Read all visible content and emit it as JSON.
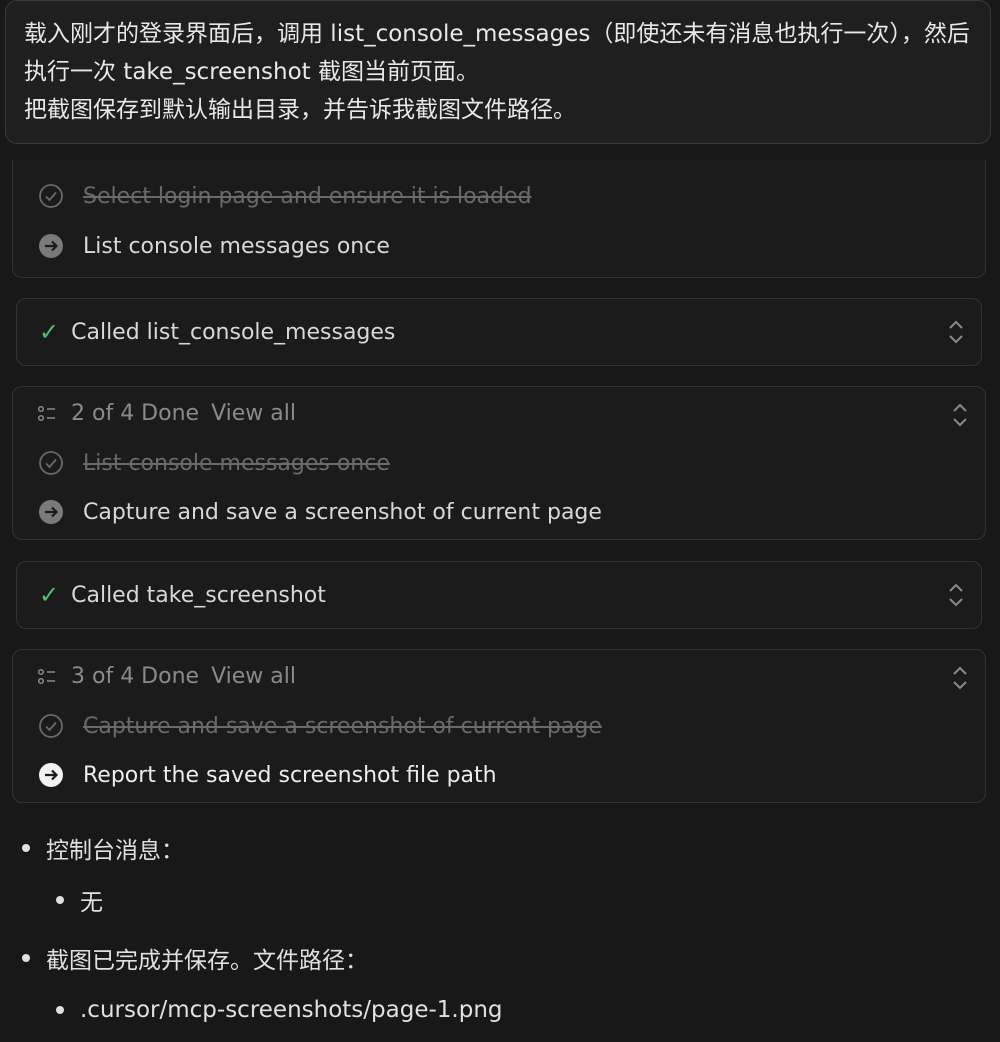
{
  "prompt": {
    "text": "载入刚才的登录界面后，调用 list_console_messages（即使还未有消息也执行一次），然后执行一次 take_screenshot 截图当前页面。\n把截图保存到默认输出目录，并告诉我截图文件路径。"
  },
  "todo1": {
    "items": [
      {
        "label": "Select login page and ensure it is loaded",
        "status": "done"
      },
      {
        "label": "List console messages once",
        "status": "current"
      }
    ]
  },
  "call1": {
    "label": "Called list_console_messages"
  },
  "todo2": {
    "progress": "2 of 4 Done",
    "view_all": "View all",
    "items": [
      {
        "label": "List console messages once",
        "status": "done"
      },
      {
        "label": "Capture and save a screenshot of current page",
        "status": "current"
      }
    ]
  },
  "call2": {
    "label": "Called take_screenshot"
  },
  "todo3": {
    "progress": "3 of 4 Done",
    "view_all": "View all",
    "items": [
      {
        "label": "Capture and save a screenshot of current page",
        "status": "done"
      },
      {
        "label": "Report the saved screenshot file path",
        "status": "current-active"
      }
    ]
  },
  "answer": {
    "console_label": "控制台消息：",
    "console_value": "无",
    "screenshot_label": "截图已完成并保存。文件路径：",
    "screenshot_path": ".cursor/mcp-screenshots/page-1.png"
  },
  "colors": {
    "background": "#181818",
    "success_green": "#4ec071",
    "muted_text": "#6a6a6a"
  }
}
